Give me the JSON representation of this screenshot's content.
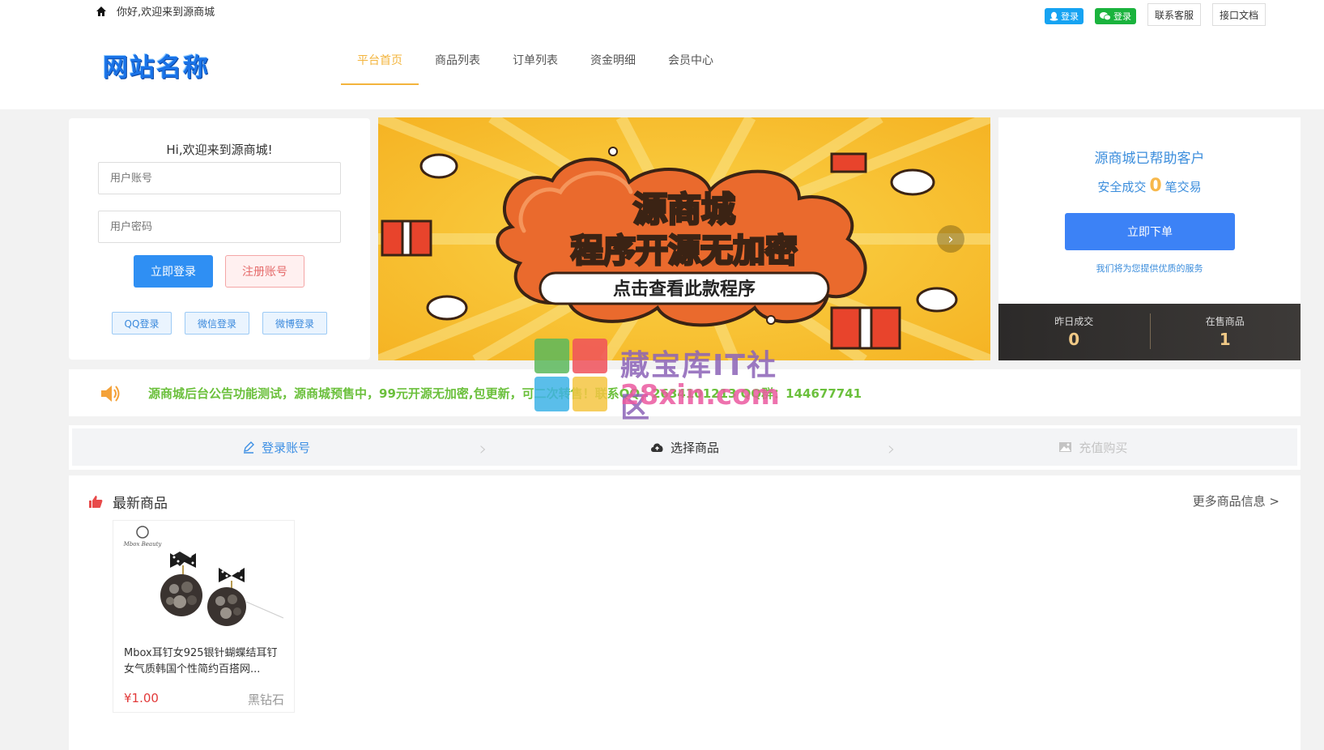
{
  "header": {
    "welcome": "你好,欢迎来到源商城",
    "qq_login": "登录",
    "wx_login": "登录",
    "support": "联系客服",
    "api_docs": "接口文档",
    "logo": "网站名称",
    "nav": [
      "平台首页",
      "商品列表",
      "订单列表",
      "资金明细",
      "会员中心"
    ],
    "accent_color": "#f3b43c"
  },
  "login": {
    "title": "Hi,欢迎来到源商城!",
    "username_placeholder": "用户账号",
    "password_placeholder": "用户密码",
    "login_button": "立即登录",
    "register_button": "注册账号",
    "social": [
      "QQ登录",
      "微信登录",
      "微博登录"
    ]
  },
  "banner": {
    "title": "源商城",
    "subtitle": "程序开源无加密",
    "cta": "点击查看此款程序"
  },
  "stats": {
    "headline": "源商城已帮助客户",
    "deals_prefix": "安全成交",
    "deals_count": "0",
    "deals_suffix": "笔交易",
    "order_button": "立即下单",
    "note": "我们将为您提供优质的服务",
    "yesterday_label": "昨日成交",
    "yesterday_value": "0",
    "on_sale_label": "在售商品",
    "on_sale_value": "1"
  },
  "notice": {
    "text": "源商城后台公告功能测试，源商城预售中，99元开源无加密,包更新，可二次转售！联系QQ：2634101213 QQ群：144677741",
    "color": "#6bc03c"
  },
  "steps": [
    "登录账号",
    "选择商品",
    "充值购买"
  ],
  "products": {
    "section_title": "最新商品",
    "more_link": "更多商品信息 >",
    "items": [
      {
        "name": "Mbox耳钉女925银针蝴蝶结耳钉女气质韩国个性简约百搭网...",
        "price": "¥1.00",
        "tag": "黑钻石",
        "image_brand": "Mbox Beauty"
      }
    ]
  },
  "watermark": {
    "line1": "藏宝库IT社区",
    "line2": "28xin.com"
  }
}
